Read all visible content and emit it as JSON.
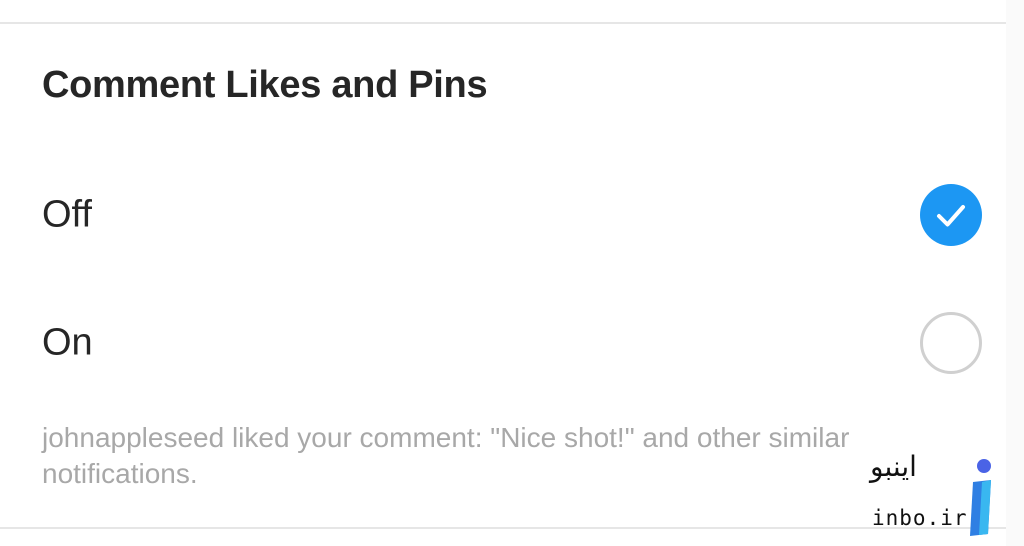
{
  "section": {
    "title": "Comment Likes and Pins"
  },
  "options": [
    {
      "label": "Off",
      "selected": true
    },
    {
      "label": "On",
      "selected": false
    }
  ],
  "description": "johnappleseed liked your comment: \"Nice shot!\" and other similar notifications.",
  "watermark": {
    "text": "اینبو",
    "domain": "inbo.ir"
  },
  "colors": {
    "accent": "#1c97f3",
    "text": "#262626",
    "secondary_text": "#a8a8a8",
    "radio_border": "#d0d0d0"
  }
}
